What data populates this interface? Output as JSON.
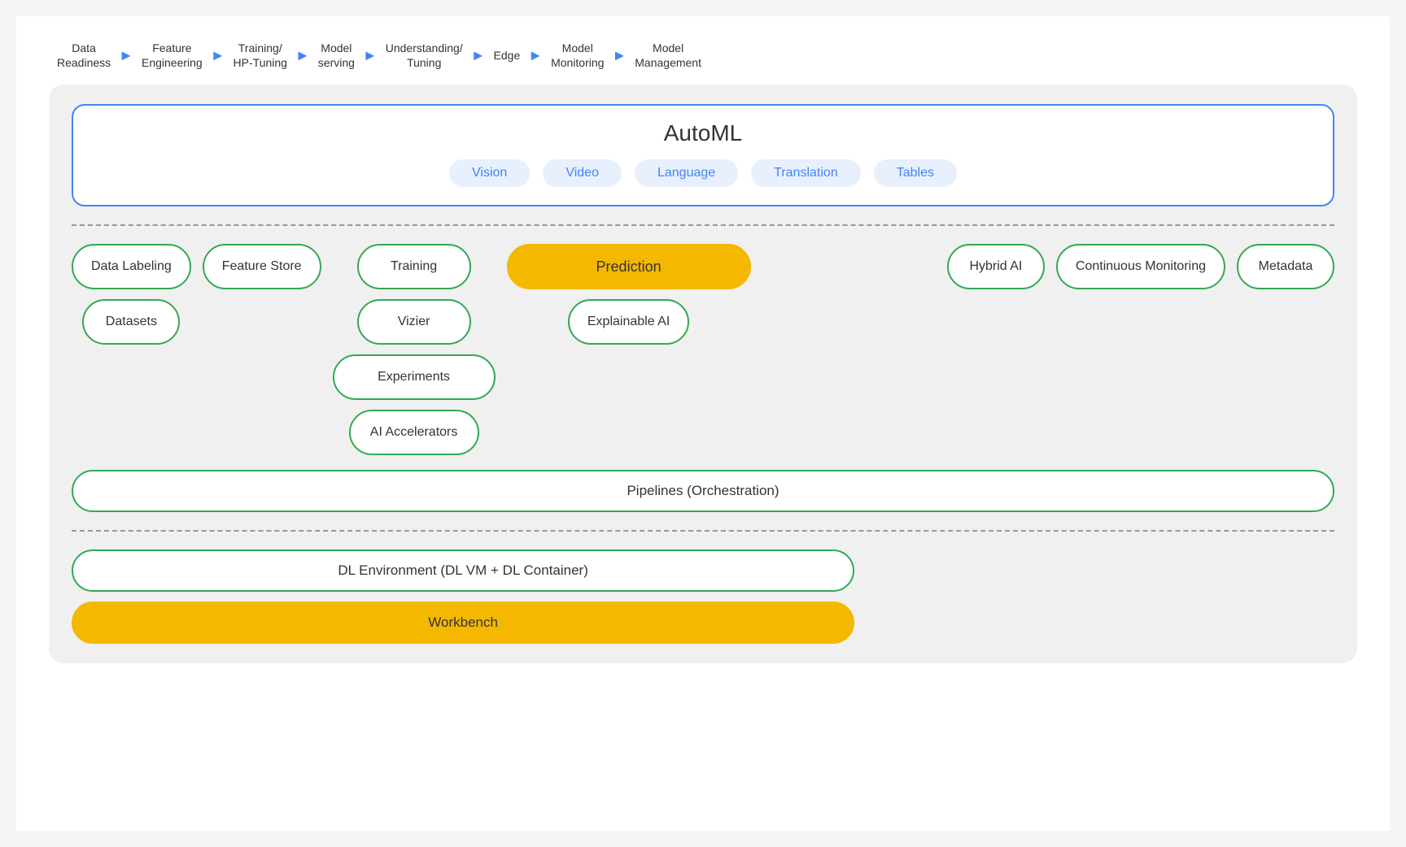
{
  "pipeline": {
    "steps": [
      {
        "label": "Data\nReadiness"
      },
      {
        "label": "Feature\nEngineering"
      },
      {
        "label": "Training/\nHP-Tuning"
      },
      {
        "label": "Model\nserving"
      },
      {
        "label": "Understanding/\nTuning"
      },
      {
        "label": "Edge"
      },
      {
        "label": "Model\nMonitoring"
      },
      {
        "label": "Model\nManagement"
      }
    ]
  },
  "automl": {
    "title": "AutoML",
    "chips": [
      "Vision",
      "Video",
      "Language",
      "Translation",
      "Tables"
    ]
  },
  "components": {
    "col1": {
      "top": "Data\nLabeling",
      "bottom": "Datasets"
    },
    "col2": {
      "top": "Feature\nStore"
    },
    "col3": {
      "top": "Training",
      "mid": "Vizier",
      "bottom1": "Experiments",
      "bottom2": "AI\nAccelerators"
    },
    "col4": {
      "top": "Prediction",
      "bottom": "Explainable\nAI"
    },
    "col5": {
      "top": "Hybrid AI"
    },
    "col6": {
      "top": "Continuous\nMonitoring"
    },
    "col7": {
      "top": "Metadata"
    }
  },
  "pipelines": {
    "label": "Pipelines (Orchestration)"
  },
  "dl": {
    "env_label": "DL Environment (DL VM + DL Container)",
    "workbench_label": "Workbench"
  }
}
